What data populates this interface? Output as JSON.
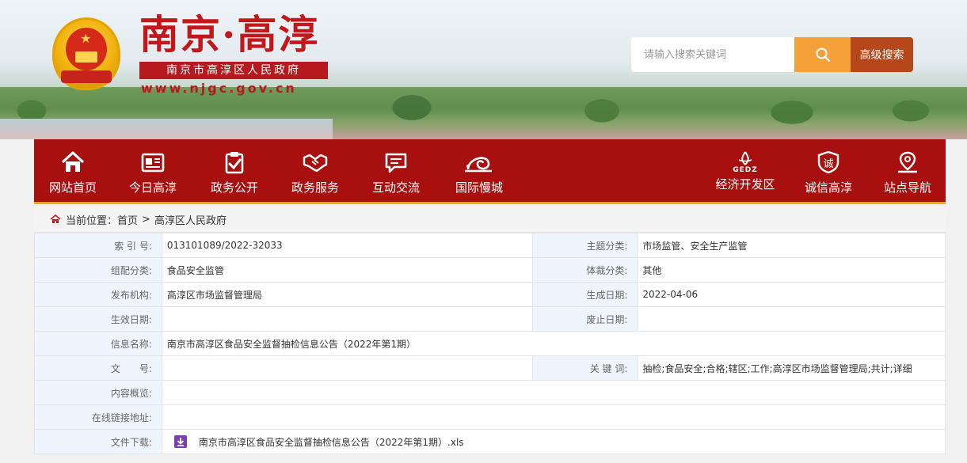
{
  "header": {
    "site_title": "南京·高淳",
    "site_subtitle": "南京市高淳区人民政府",
    "site_domain": "www.njgc.gov.cn",
    "search_placeholder": "请输入搜索关键词",
    "advanced_search_label": "高级搜索",
    "search_icon": "search-icon",
    "emblem_icon": "national-emblem-icon"
  },
  "nav": {
    "left": [
      {
        "label": "网站首页",
        "icon": "home-icon"
      },
      {
        "label": "今日高淳",
        "icon": "newspaper-icon"
      },
      {
        "label": "政务公开",
        "icon": "clipboard-check-icon"
      },
      {
        "label": "政务服务",
        "icon": "handshake-icon"
      },
      {
        "label": "互动交流",
        "icon": "chat-icon"
      },
      {
        "label": "国际慢城",
        "icon": "snail-icon"
      }
    ],
    "right": [
      {
        "label": "经济开发区",
        "icon": "gedz-logo-icon",
        "logo_text": "GEDZ"
      },
      {
        "label": "诚信高淳",
        "icon": "integrity-shield-icon",
        "logo_text": "诚"
      },
      {
        "label": "站点导航",
        "icon": "location-pin-icon"
      }
    ]
  },
  "breadcrumb": {
    "prefix": "当前位置：",
    "items": [
      "首页",
      "高淳区人民政府"
    ],
    "separator": ">"
  },
  "info_table": {
    "rows": [
      {
        "k1": "索 引 号:",
        "v1": "013101089/2022-32033",
        "k2": "主题分类:",
        "v2": "市场监管、安全生产监管"
      },
      {
        "k1": "组配分类:",
        "v1": "食品安全监管",
        "k2": "体裁分类:",
        "v2": "其他"
      },
      {
        "k1": "发布机构:",
        "v1": "高淳区市场监督管理局",
        "k2": "生成日期:",
        "v2": "2022-04-06"
      },
      {
        "k1": "生效日期:",
        "v1": "",
        "k2": "废止日期:",
        "v2": ""
      }
    ],
    "title_row": {
      "k": "信息名称:",
      "v": "南京市高淳区食品安全监督抽检信息公告（2022年第1期）"
    },
    "doc_row": {
      "k1": "文　　号:",
      "v1": "",
      "k2": "关 键 词:",
      "v2": "抽检;食品安全;合格;辖区;工作;高淳区市场监督管理局;共计;详细"
    },
    "summary_row": {
      "k": "内容概览:",
      "v": ""
    },
    "link_row": {
      "k": "在线链接地址:",
      "v": ""
    },
    "download_row": {
      "k": "文件下载:",
      "file_name": "南京市高淳区食品安全监督抽检信息公告（2022年第1期）.xls",
      "icon": "download-file-icon"
    }
  },
  "colors": {
    "nav_bg": "#a80f0f",
    "nav_accent": "#e9b200",
    "search_btn": "#f4a13a",
    "advanced_btn": "#b5471a",
    "title_red": "#c3171c",
    "label_cell_bg": "#eef5fc"
  }
}
